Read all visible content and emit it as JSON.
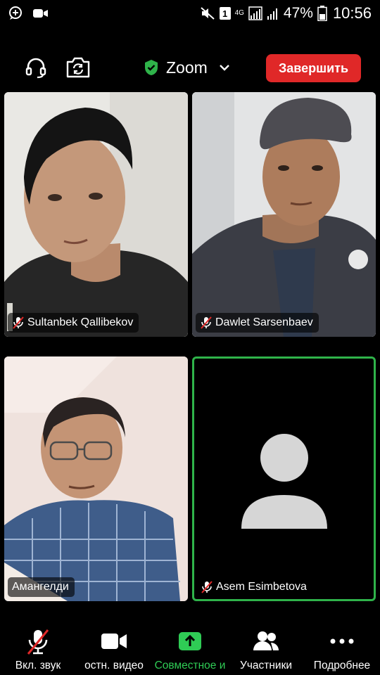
{
  "status_bar": {
    "sim_badge": "1",
    "network": "4G",
    "battery": "47%",
    "time": "10:56",
    "icons": [
      "notification-icon",
      "video-call-icon",
      "mute-icon",
      "sim-icon",
      "signal-icon",
      "signal-icon",
      "battery-icon"
    ]
  },
  "top_bar": {
    "meeting_title": "Zoom",
    "end_label": "Завершить",
    "colors": {
      "end": "#e02828",
      "shield": "#2fb34a"
    }
  },
  "participants": [
    {
      "name": "Sultanbek Qallibekov",
      "muted": true,
      "video": true
    },
    {
      "name": "Dawlet Sarsenbaev",
      "muted": true,
      "video": true
    },
    {
      "name": "Амангелди",
      "muted": false,
      "video": true
    },
    {
      "name": "Asem Esimbetova",
      "muted": true,
      "video": false,
      "active_speaker": true
    }
  ],
  "bottom_bar": {
    "items": [
      {
        "label": "Вкл. звук",
        "icon": "mic-muted-icon"
      },
      {
        "label": "остн. видео",
        "icon": "video-camera-icon"
      },
      {
        "label": "Совместное и",
        "icon": "share-screen-icon"
      },
      {
        "label": "Участники",
        "icon": "participants-icon"
      },
      {
        "label": "Подробнее",
        "icon": "more-icon"
      }
    ],
    "colors": {
      "share": "#2fcc55"
    }
  }
}
